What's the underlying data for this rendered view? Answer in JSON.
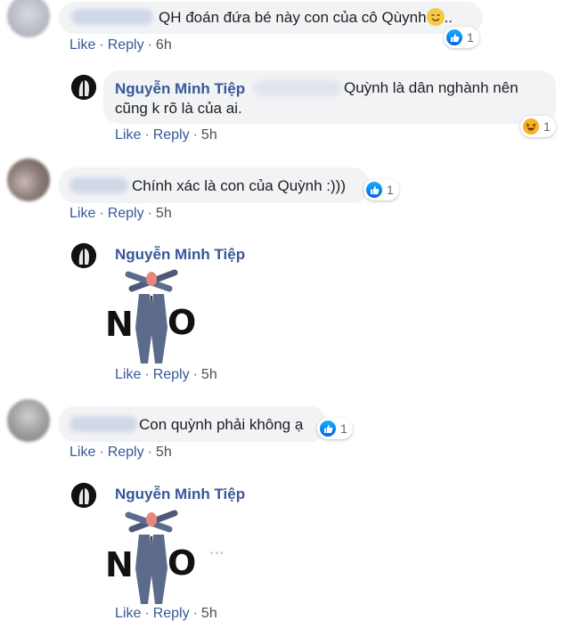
{
  "comments": [
    {
      "text": "QH đoán đứa bé này con của cô Qùynh",
      "text_suffix": "..",
      "actions": {
        "like": "Like",
        "reply": "Reply",
        "time": "6h"
      },
      "reaction": {
        "icon": "like-icon",
        "count": "1"
      }
    },
    {
      "author": "Nguyễn Minh Tiệp",
      "text_line1": "Quỳnh là dân nghành nên",
      "text_line2": "cũng k rõ là của ai.",
      "actions": {
        "like": "Like",
        "reply": "Reply",
        "time": "5h"
      },
      "reaction": {
        "icon": "haha-icon",
        "count": "1"
      }
    },
    {
      "text": "Chính xác là con của Quỳnh :)))",
      "actions": {
        "like": "Like",
        "reply": "Reply",
        "time": "5h"
      },
      "reaction": {
        "icon": "like-icon",
        "count": "1"
      }
    },
    {
      "author": "Nguyễn Minh Tiệp",
      "sticker": {
        "letter1": "N",
        "letter2": "O"
      },
      "actions": {
        "like": "Like",
        "reply": "Reply",
        "time": "5h"
      }
    },
    {
      "text": "Con quỳnh phải không ạ",
      "actions": {
        "like": "Like",
        "reply": "Reply",
        "time": "5h"
      },
      "reaction": {
        "icon": "like-icon",
        "count": "1"
      }
    },
    {
      "author": "Nguyễn Minh Tiệp",
      "sticker": {
        "letter1": "N",
        "letter2": "O"
      },
      "more": "•••",
      "actions": {
        "like": "Like",
        "reply": "Reply",
        "time": "5h"
      }
    }
  ],
  "separator": "·",
  "colors": {
    "link": "#385898",
    "bubble": "#f2f3f5",
    "like_blue": "#1877f2",
    "haha_yellow": "#f7b125"
  }
}
